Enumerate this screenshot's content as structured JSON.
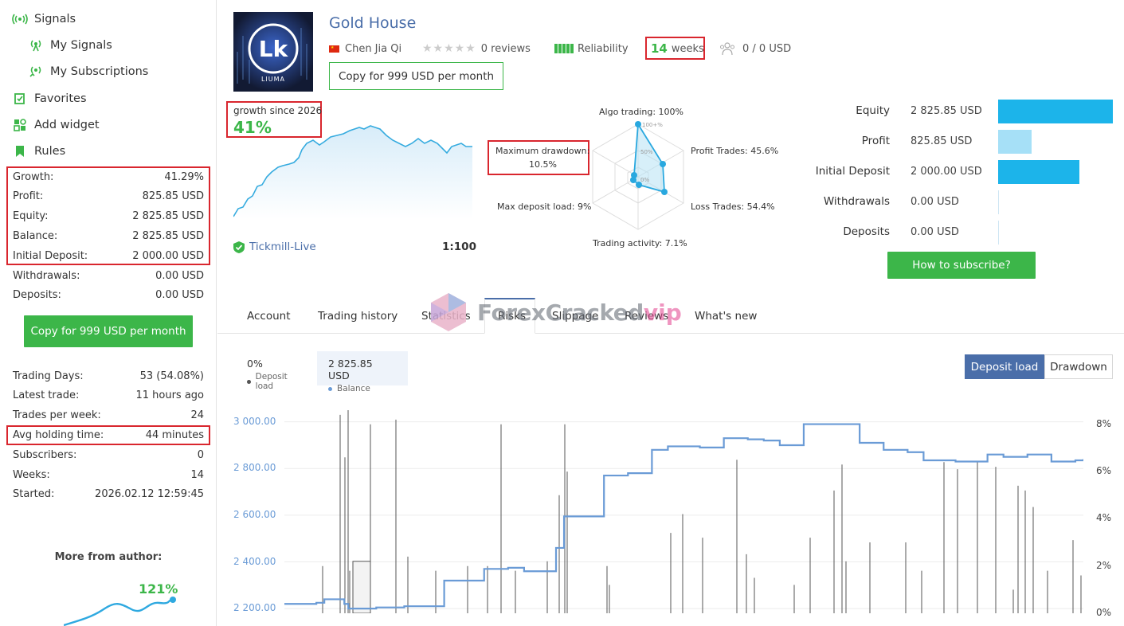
{
  "sidebar": {
    "nav": [
      {
        "label": "Signals",
        "icon": "signal-icon"
      },
      {
        "label": "My Signals",
        "icon": "signal-icon"
      },
      {
        "label": "My Subscriptions",
        "icon": "signal-icon"
      },
      {
        "label": "Favorites",
        "icon": "favorites-icon"
      },
      {
        "label": "Add widget",
        "icon": "widget-icon"
      },
      {
        "label": "Rules",
        "icon": "rules-icon"
      }
    ],
    "stats": [
      {
        "label": "Growth:",
        "value": "41.29%"
      },
      {
        "label": "Profit:",
        "value": "825.85 USD"
      },
      {
        "label": "Equity:",
        "value": "2 825.85 USD"
      },
      {
        "label": "Balance:",
        "value": "2 825.85 USD"
      },
      {
        "label": "Initial Deposit:",
        "value": "2 000.00 USD"
      },
      {
        "label": "Withdrawals:",
        "value": "0.00 USD"
      },
      {
        "label": "Deposits:",
        "value": "0.00 USD"
      }
    ],
    "copy_button": "Copy for 999 USD per month",
    "stats2": [
      {
        "label": "Trading Days:",
        "value": "53 (54.08%)"
      },
      {
        "label": "Latest trade:",
        "value": "11 hours ago"
      },
      {
        "label": "Trades per week:",
        "value": "24"
      },
      {
        "label": "Avg holding time:",
        "value": "44 minutes"
      },
      {
        "label": "Subscribers:",
        "value": "0"
      },
      {
        "label": "Weeks:",
        "value": "14"
      },
      {
        "label": "Started:",
        "value": "2026.02.12 12:59:45"
      }
    ],
    "more_from_author": "More from author:",
    "author_growth": "121%"
  },
  "header": {
    "title": "Gold House",
    "logo_text": "LIUMA",
    "author": "Chen Jia Qi",
    "reviews": "0 reviews",
    "reliability": "Reliability",
    "weeks_num": "14",
    "weeks_word": "weeks",
    "subscribers": "0 / 0 USD",
    "copy_button": "Copy for 999 USD per month"
  },
  "growth": {
    "label": "growth since 2026",
    "value": "41%",
    "broker": "Tickmill-Live",
    "leverage": "1:100"
  },
  "radar": {
    "algo": "Algo trading: 100%",
    "profit_trades": "Profit Trades: 45.6%",
    "loss_trades": "Loss Trades: 54.4%",
    "activity": "Trading activity: 7.1%",
    "max_load": "Max deposit load: 9%",
    "max_dd_label": "Maximum drawdown:",
    "max_dd_value": "10.5%",
    "ring_100": "100+%",
    "ring_50": "50%",
    "ring_0": "0%"
  },
  "summary": [
    {
      "label": "Equity",
      "value": "2 825.85 USD",
      "fraction": 1.0,
      "color": "#1cb4ea"
    },
    {
      "label": "Profit",
      "value": "825.85 USD",
      "fraction": 0.29,
      "color": "#a6e0f7"
    },
    {
      "label": "Initial Deposit",
      "value": "2 000.00 USD",
      "fraction": 0.71,
      "color": "#1cb4ea"
    },
    {
      "label": "Withdrawals",
      "value": "0.00 USD",
      "fraction": 0,
      "color": "#1cb4ea"
    },
    {
      "label": "Deposits",
      "value": "0.00 USD",
      "fraction": 0,
      "color": "#1cb4ea"
    }
  ],
  "subscribe_button": "How to subscribe?",
  "tabs": [
    "Account",
    "Trading history",
    "Statistics",
    "Risks",
    "Slippage",
    "Reviews",
    "What's new"
  ],
  "watermark": {
    "main": "ForexCracked",
    "suffix": "vip"
  },
  "legend": {
    "load_value": "0%",
    "load_label": "Deposit load",
    "balance_value": "2 825.85 USD",
    "balance_label": "Balance"
  },
  "toggles": {
    "deposit_load": "Deposit load",
    "drawdown": "Drawdown"
  },
  "colors": {
    "accent_green": "#3cb649",
    "brand_blue": "#4a6ea9",
    "highlight_red": "#d9262e",
    "balance_line": "#6a9bd6"
  },
  "chart_data": {
    "type": "line",
    "series": [
      {
        "name": "Balance",
        "axis": "left",
        "x": [
          0,
          0.04,
          0.05,
          0.075,
          0.08,
          0.115,
          0.15,
          0.2,
          0.25,
          0.28,
          0.3,
          0.34,
          0.35,
          0.4,
          0.43,
          0.46,
          0.48,
          0.52,
          0.55,
          0.58,
          0.6,
          0.62,
          0.65,
          0.68,
          0.72,
          0.75,
          0.78,
          0.8,
          0.82,
          0.84,
          0.88,
          0.9,
          0.93,
          0.96,
          0.99,
          1.0
        ],
        "y": [
          2220,
          2225,
          2240,
          2220,
          2200,
          2205,
          2210,
          2320,
          2370,
          2375,
          2360,
          2460,
          2595,
          2770,
          2780,
          2880,
          2895,
          2890,
          2930,
          2925,
          2920,
          2900,
          2990,
          2990,
          2910,
          2880,
          2870,
          2835,
          2835,
          2830,
          2860,
          2850,
          2860,
          2830,
          2835,
          2840
        ]
      },
      {
        "name": "Deposit load",
        "axis": "right"
      }
    ],
    "y_left": {
      "ticks": [
        "3 000.00",
        "2 800.00",
        "2 600.00",
        "2 400.00",
        "2 200.00"
      ],
      "range": [
        2180,
        3050
      ]
    },
    "y_right": {
      "ticks": [
        "8%",
        "6%",
        "4%",
        "2%",
        "0%"
      ],
      "range": [
        0,
        8.6
      ]
    },
    "grid": true
  }
}
